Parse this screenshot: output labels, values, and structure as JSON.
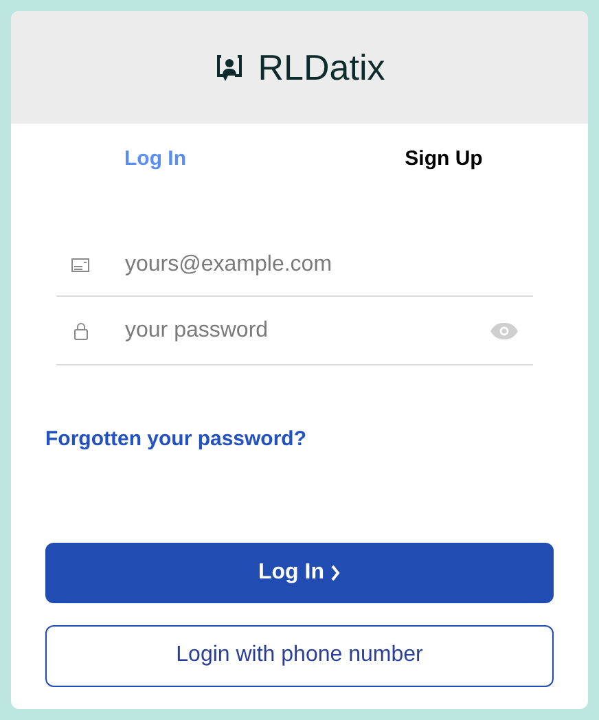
{
  "logo": {
    "text": "RLDatix"
  },
  "tabs": [
    {
      "label": "Log In",
      "selected": true
    },
    {
      "label": "Sign Up",
      "selected": false
    }
  ],
  "email": {
    "placeholder": "yours@example.com"
  },
  "password": {
    "placeholder": "your password"
  },
  "forgot_link": "Forgotten your password?",
  "login_button": "Log In",
  "phone_button": "Login with phone number"
}
